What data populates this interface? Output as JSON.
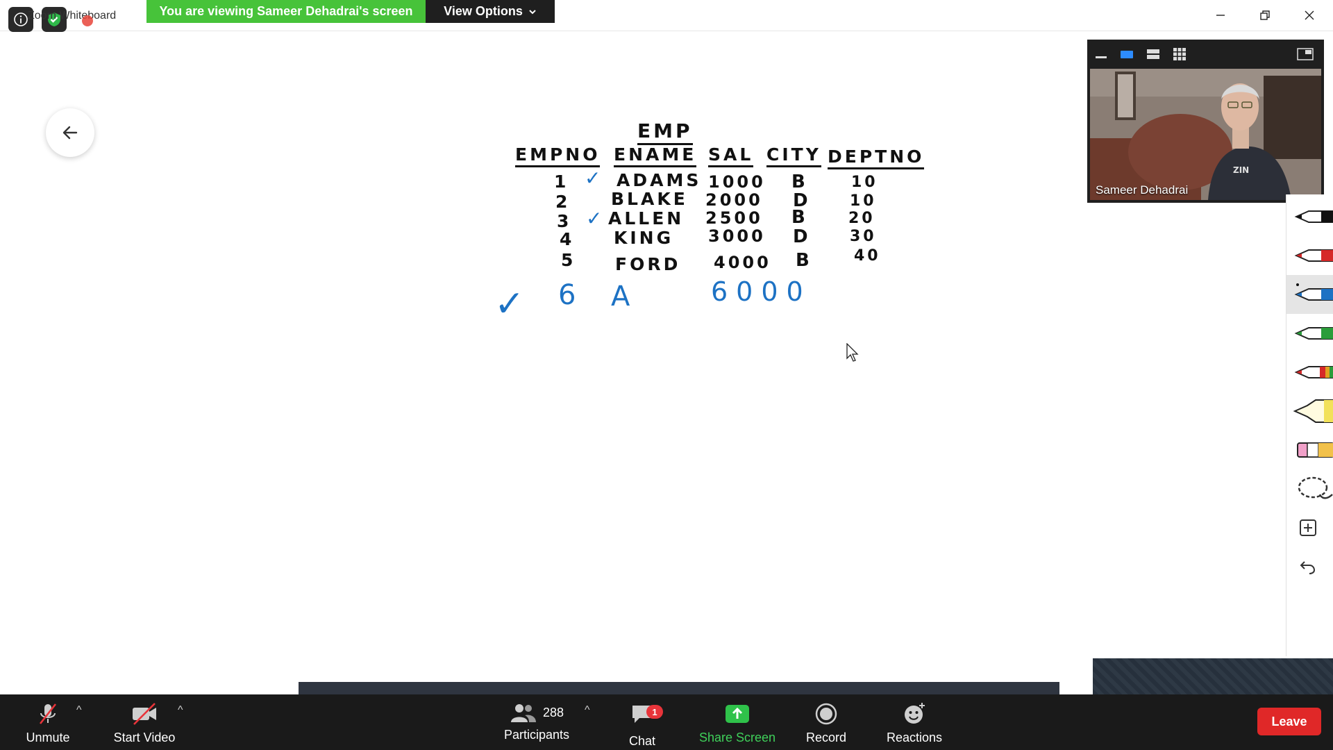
{
  "titlebar": {
    "title": "Zoom Whiteboard",
    "viewing_banner": "You are viewing Sameer Dehadrai's screen",
    "view_options_label": "View Options"
  },
  "whiteboard": {
    "table_title": "EMP",
    "headers": [
      "EMPNO",
      "ENAME",
      "SAL",
      "CITY",
      "DEPTNO"
    ],
    "rows": [
      {
        "empno": "1",
        "ename": "ADAMS",
        "sal": "1000",
        "city": "B",
        "deptno": "10",
        "check": "✓"
      },
      {
        "empno": "2",
        "ename": "BLAKE",
        "sal": "2000",
        "city": "D",
        "deptno": "10",
        "check": ""
      },
      {
        "empno": "3",
        "ename": "ALLEN",
        "sal": "2500",
        "city": "B",
        "deptno": "20",
        "check": "✓"
      },
      {
        "empno": "4",
        "ename": "KING",
        "sal": "3000",
        "city": "D",
        "deptno": "30",
        "check": ""
      },
      {
        "empno": "5",
        "ename": "FORD",
        "sal": "4000",
        "city": "B",
        "deptno": "40",
        "check": ""
      }
    ],
    "new_row": {
      "check": "✓",
      "empno": "6",
      "ename": "A",
      "sal": "6000"
    }
  },
  "video": {
    "participant_name": "Sameer Dehadrai"
  },
  "pen_tools": [
    {
      "name": "black-marker",
      "color": "#111111"
    },
    {
      "name": "red-marker",
      "color": "#d62828"
    },
    {
      "name": "blue-marker",
      "color": "#1d72c4",
      "selected": true
    },
    {
      "name": "green-marker",
      "color": "#2a9d3a"
    },
    {
      "name": "multicolor-marker",
      "color": "#e05a2a"
    },
    {
      "name": "yellow-highlighter",
      "color": "#f2e15a"
    },
    {
      "name": "eraser",
      "color": "#f0a0c8"
    },
    {
      "name": "lasso",
      "color": "#555555"
    },
    {
      "name": "add",
      "color": "#333333"
    },
    {
      "name": "undo",
      "color": "#333333"
    }
  ],
  "bottombar": {
    "unmute_label": "Unmute",
    "start_video_label": "Start Video",
    "participants_label": "Participants",
    "participants_count": "288",
    "chat_label": "Chat",
    "chat_badge": "1",
    "share_screen_label": "Share Screen",
    "record_label": "Record",
    "reactions_label": "Reactions",
    "leave_label": "Leave"
  }
}
